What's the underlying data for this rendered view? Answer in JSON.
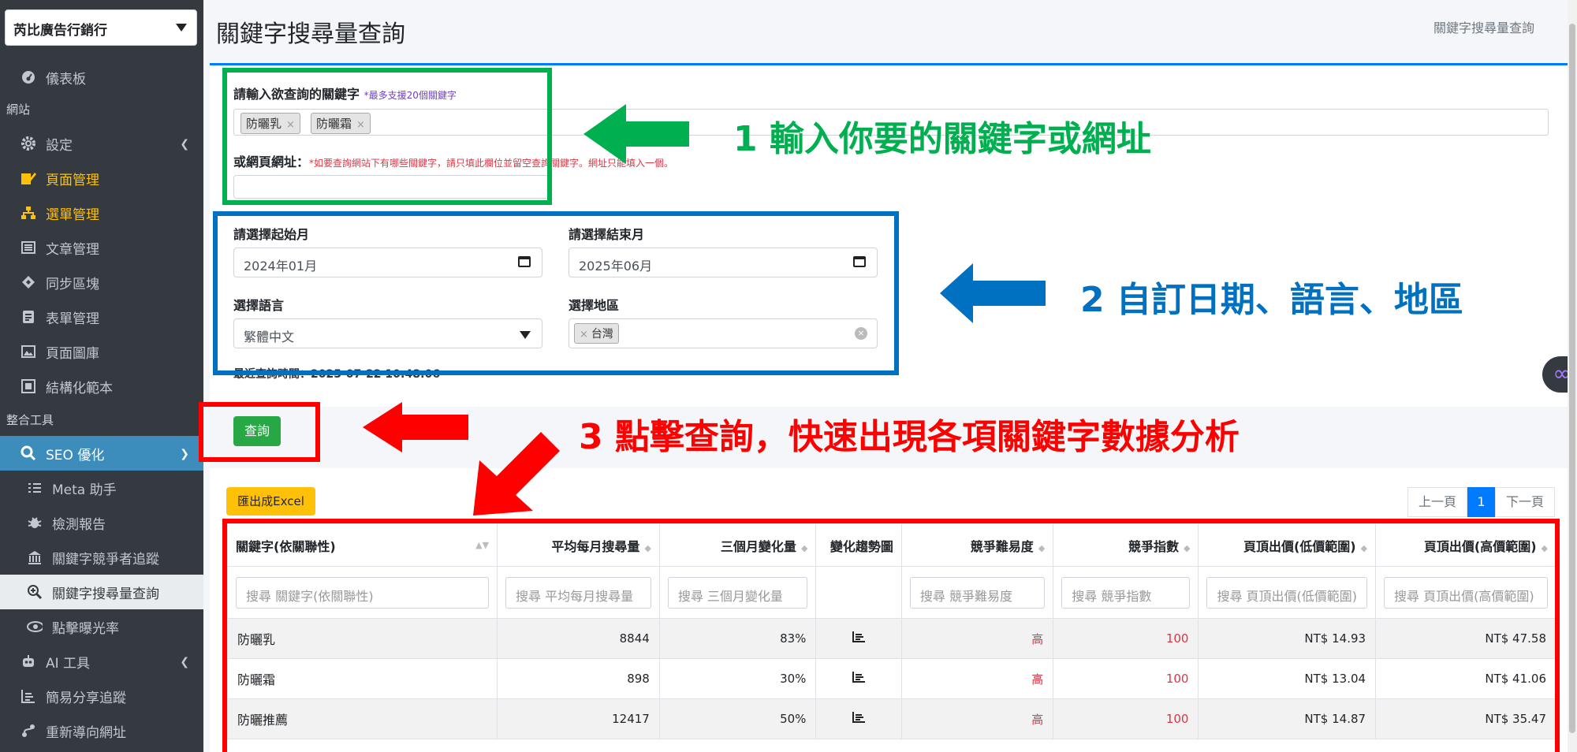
{
  "sidebar": {
    "site_selector": "芮比廣告行銷行",
    "items": [
      {
        "label": "儀表板",
        "icon": "dashboard-icon"
      },
      {
        "header": "網站"
      },
      {
        "label": "設定",
        "icon": "gear-icon"
      },
      {
        "label": "頁面管理",
        "icon": "edit-icon"
      },
      {
        "label": "選單管理",
        "icon": "sitemap-icon"
      },
      {
        "label": "文章管理",
        "icon": "list-icon"
      },
      {
        "label": "同步區塊",
        "icon": "diamond-icon"
      },
      {
        "label": "表單管理",
        "icon": "form-icon"
      },
      {
        "label": "頁面圖庫",
        "icon": "image-icon"
      },
      {
        "label": "結構化範本",
        "icon": "structure-icon"
      },
      {
        "header": "整合工具"
      },
      {
        "label": "SEO 優化",
        "icon": "search-icon"
      },
      {
        "label": "Meta 助手",
        "icon": "list-icon"
      },
      {
        "label": "檢測報告",
        "icon": "bug-icon"
      },
      {
        "label": "關鍵字競爭者追蹤",
        "icon": "building-icon"
      },
      {
        "label": "關鍵字搜尋量查詢",
        "icon": "zoom-icon"
      },
      {
        "label": "點擊曝光率",
        "icon": "eye-icon"
      },
      {
        "label": "AI 工具",
        "icon": "robot-icon"
      },
      {
        "label": "簡易分享追蹤",
        "icon": "chart-icon"
      },
      {
        "label": "重新導向網址",
        "icon": "route-icon"
      }
    ]
  },
  "header": {
    "title": "關鍵字搜尋量查詢",
    "breadcrumb": "關鍵字搜尋量查詢"
  },
  "form": {
    "keyword_label": "請輸入欲查詢的關鍵字",
    "keyword_hint": "*最多支援20個關鍵字",
    "keywords": [
      "防曬乳",
      "防曬霜"
    ],
    "url_label": "或網頁網址：",
    "url_hint": "*如要查詢網站下有哪些關鍵字，請只填此欄位並留空查詢關鍵字。網址只能填入一個。",
    "start_label": "請選擇起始月",
    "start_value": "2024年01月",
    "end_label": "請選擇結束月",
    "end_value": "2025年06月",
    "lang_label": "選擇語言",
    "lang_value": "繁體中文",
    "region_label": "選擇地區",
    "region_value": "台灣",
    "last_query": "最近查詢時間：2025-07-22 10:48:06",
    "submit": "查詢"
  },
  "results": {
    "export": "匯出成Excel",
    "pager": {
      "prev": "上一頁",
      "current": "1",
      "next": "下一頁"
    },
    "columns": [
      "關鍵字(依關聯性)",
      "平均每月搜尋量",
      "三個月變化量",
      "變化趨勢圖",
      "競爭難易度",
      "競爭指數",
      "頁頂出價(低價範圍)",
      "頁頂出價(高價範圍)"
    ],
    "search_placeholders": [
      "搜尋 關鍵字(依關聯性)",
      "搜尋 平均每月搜尋量",
      "搜尋 三個月變化量",
      "",
      "搜尋 競爭難易度",
      "搜尋 競爭指數",
      "搜尋 頁頂出價(低價範圍)",
      "搜尋 頁頂出價(高價範圍)"
    ],
    "rows": [
      [
        "防曬乳",
        "8844",
        "83%",
        "高",
        "100",
        "NT$ 14.93",
        "NT$ 47.58"
      ],
      [
        "防曬霜",
        "898",
        "30%",
        "高",
        "100",
        "NT$ 13.04",
        "NT$ 41.06"
      ],
      [
        "防曬推薦",
        "12417",
        "50%",
        "高",
        "100",
        "NT$ 14.87",
        "NT$ 35.47"
      ]
    ]
  },
  "annotations": {
    "step1": "1 輸入你要的關鍵字或網址",
    "step2": "2 自訂日期、語言、地區",
    "step3": "3 點擊查詢，快速出現各項關鍵字數據分析"
  },
  "colors": {
    "green": "#00b050",
    "blue": "#0070c0",
    "red": "#ff0000",
    "sidebar_bg": "#343a40",
    "active": "#3c8dbc",
    "highlight": "#ffc107"
  }
}
